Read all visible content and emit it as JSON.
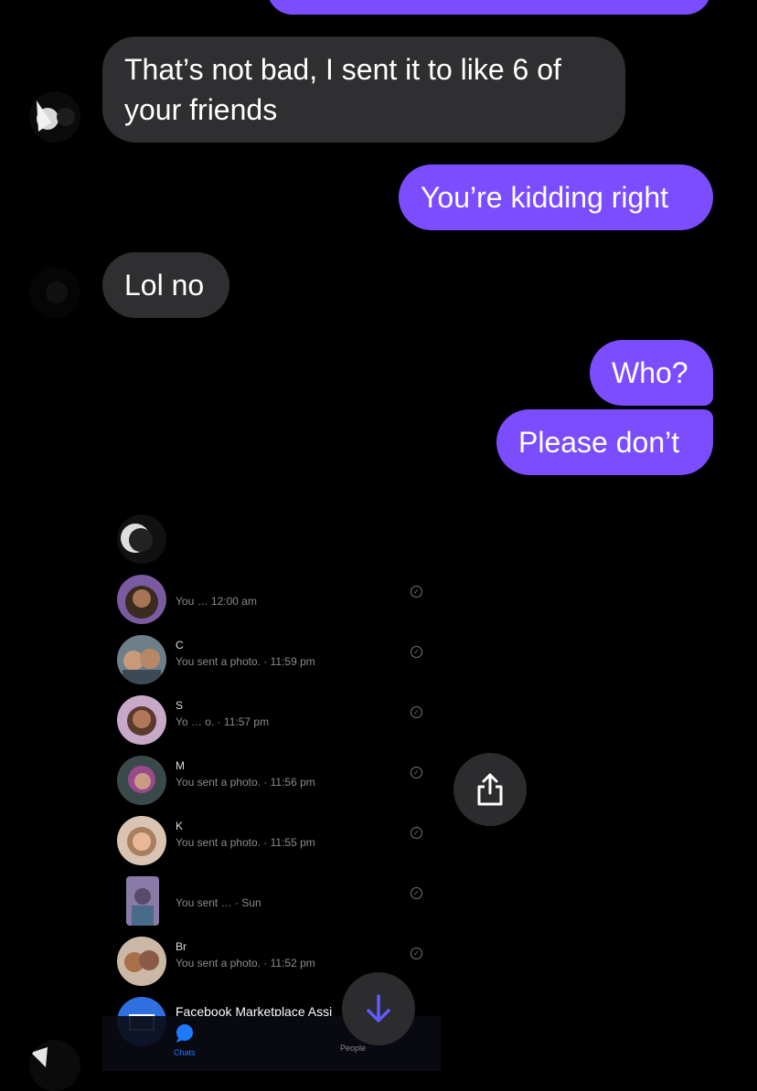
{
  "messages": [
    {
      "text_lines": [
        "That’s not bad, I sent it to like 6 of",
        "your friends"
      ],
      "side": "incoming"
    },
    {
      "text": "You’re kidding right",
      "side": "outgoing"
    },
    {
      "text": "Lol no",
      "side": "incoming"
    },
    {
      "text": "Who?",
      "side": "outgoing"
    },
    {
      "text": "Please don’t",
      "side": "outgoing"
    }
  ],
  "shared_screenshot": {
    "rows": [
      {
        "name": "",
        "meta": "",
        "check": ""
      },
      {
        "name": "",
        "meta": "You … 12:00 am",
        "check": "✓"
      },
      {
        "name": "C",
        "meta": "You sent a photo. · 11:59 pm",
        "check": "✓"
      },
      {
        "name": "S",
        "meta": "Yo … o. · 11:57 pm",
        "check": "✓"
      },
      {
        "name": "M",
        "meta": "You sent a photo. · 11:56 pm",
        "check": "✓"
      },
      {
        "name": "K",
        "meta": "You sent a photo. · 11:55 pm",
        "check": "✓"
      },
      {
        "name": "",
        "meta": "You sent … · Sun",
        "check": "✓"
      },
      {
        "name": "Br",
        "meta": "You sent a photo. · 11:52 pm",
        "check": "✓"
      },
      {
        "name": "Facebook Marketplace Assi",
        "meta": "",
        "check": ""
      }
    ],
    "tabs": {
      "chats": "Chats",
      "people": "People"
    }
  },
  "icons": {
    "share": "share-icon",
    "scroll_down": "arrow-down-icon"
  },
  "colors": {
    "outgoing": "#7b4dff",
    "incoming": "#2f2f31",
    "arrow": "#5f5bff"
  }
}
